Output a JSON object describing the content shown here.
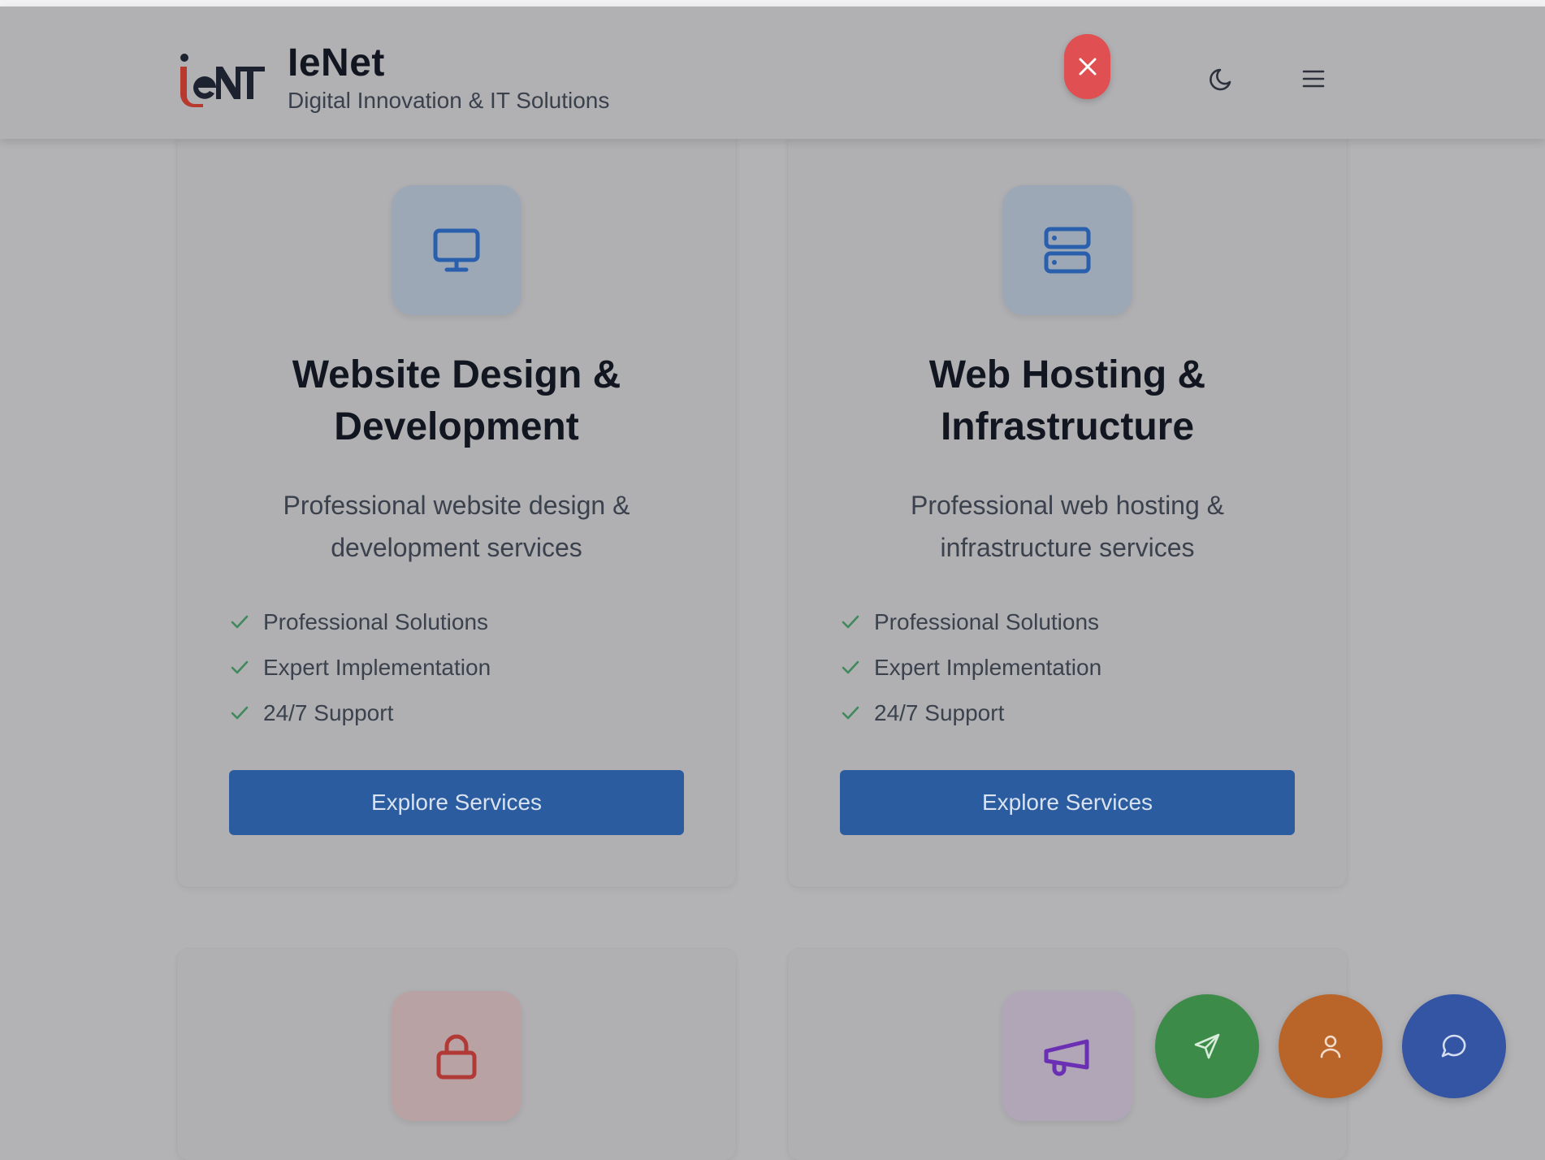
{
  "header": {
    "brand_name": "IeNet",
    "brand_tagline": "Digital Innovation & IT Solutions",
    "logo_icon": "ienet-logo",
    "close_icon": "close-icon",
    "theme_icon": "moon-icon",
    "menu_icon": "menu-icon"
  },
  "services": [
    {
      "icon": "monitor-icon",
      "title": "Website Design & Development",
      "description": "Professional website design & development services",
      "features": [
        "Professional Solutions",
        "Expert Implementation",
        "24/7 Support"
      ],
      "button_label": "Explore Services"
    },
    {
      "icon": "server-icon",
      "title": "Web Hosting & Infrastructure",
      "description": "Professional web hosting & infrastructure services",
      "features": [
        "Professional Solutions",
        "Expert Implementation",
        "24/7 Support"
      ],
      "button_label": "Explore Services"
    },
    {
      "icon": "lock-icon"
    },
    {
      "icon": "megaphone-icon"
    }
  ],
  "floating_actions": [
    {
      "icon": "send-icon",
      "color": "#3d8b48"
    },
    {
      "icon": "user-icon",
      "color": "#b9652a"
    },
    {
      "icon": "chat-icon",
      "color": "#3454a4"
    }
  ],
  "colors": {
    "primary": "#2a5c9f",
    "close": "#e04f51",
    "check": "#3f8a5c"
  }
}
